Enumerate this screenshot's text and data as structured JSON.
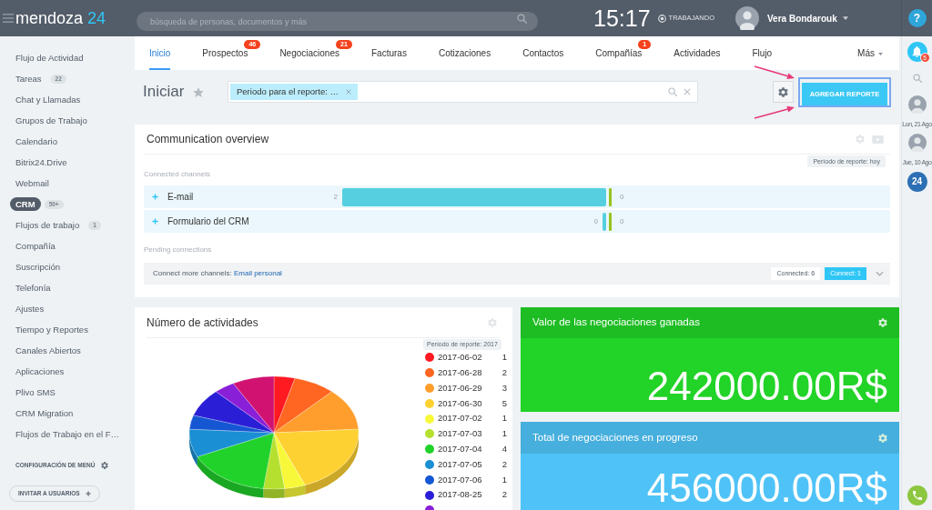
{
  "top_bar": {
    "logo": {
      "name": "mendoza",
      "number": "24"
    },
    "search": {
      "placeholder": "búsqueda de personas, documentos y más"
    },
    "clock": "15:17",
    "work_status": "TRABAJANDO",
    "user_name": "Vera Bondarouk",
    "help": "?"
  },
  "sidebar": {
    "items": [
      {
        "label": "Flujo de Actividad",
        "selected": false
      },
      {
        "label": "Tareas",
        "badge": "22",
        "selected": false
      },
      {
        "label": "Chat y Llamadas",
        "selected": false
      },
      {
        "label": "Grupos de Trabajo",
        "selected": false
      },
      {
        "label": "Calendario",
        "selected": false
      },
      {
        "label": "Bitrix24.Drive",
        "selected": false
      },
      {
        "label": "Webmail",
        "selected": false
      },
      {
        "label": "CRM",
        "badge": "50+",
        "selected": true
      },
      {
        "label": "Flujos de trabajo",
        "badge": "1",
        "selected": false
      },
      {
        "label": "Compañía",
        "selected": false
      },
      {
        "label": "Suscripción",
        "selected": false
      },
      {
        "label": "Telefonía",
        "selected": false
      },
      {
        "label": "Ajustes",
        "selected": false
      },
      {
        "label": "Tiempo y Reportes",
        "selected": false
      },
      {
        "label": "Canales Abiertos",
        "selected": false
      },
      {
        "label": "Aplicaciones",
        "selected": false
      },
      {
        "label": "Plivo SMS",
        "selected": false
      },
      {
        "label": "CRM Migration",
        "selected": false
      },
      {
        "label": "Flujos de Trabajo en el F…",
        "selected": false
      }
    ],
    "menu_settings": "CONFIGURACIÓN DE MENÚ",
    "invite_button": "INVITAR A USUARIOS"
  },
  "tabs": [
    {
      "label": "Inicio",
      "kind": "tab",
      "selected": true
    },
    {
      "label": "Prospectos",
      "kind": "tab",
      "badge": "46",
      "selected": false
    },
    {
      "label": "Negociaciones",
      "kind": "tab",
      "badge": "21",
      "selected": false
    },
    {
      "label": "Facturas",
      "kind": "tab",
      "selected": false
    },
    {
      "label": "Cotizaciones",
      "kind": "tab",
      "selected": false
    },
    {
      "label": "Contactos",
      "kind": "tab",
      "selected": false
    },
    {
      "label": "Compañías",
      "kind": "tab",
      "badge": "1",
      "selected": false
    },
    {
      "label": "Actividades",
      "kind": "tab",
      "selected": false
    },
    {
      "label": "Flujo",
      "kind": "tab",
      "selected": false
    },
    {
      "label": "Más",
      "kind": "menu",
      "selected": false
    }
  ],
  "page_header": {
    "title": "Iniciar",
    "filter": {
      "tag": "Periodo para el reporte: …"
    },
    "add_button": "AGREGAR REPORTE"
  },
  "communication_overview": {
    "title": "Communication overview",
    "period": "Período de reporte: hoy",
    "connected_heading": "Connected channels",
    "chart_data": {
      "type": "bar",
      "orientation": "horizontal",
      "categories": [
        "E-mail",
        "Formulario del CRM"
      ],
      "series": [
        {
          "color": "#56d0e0",
          "values": [
            2,
            0
          ]
        },
        {
          "color": "#98c21e",
          "values": [
            0,
            0
          ]
        }
      ],
      "data_labels": true
    },
    "pending_heading": "Pending connections",
    "pending": {
      "text": "Connect more channels: ",
      "link": "Email personal",
      "connected": "Connected: 6",
      "connect": "Connect: 1"
    }
  },
  "activities": {
    "title": "Número de actividades",
    "period": "Período de reporte: 2017",
    "legend": [
      {
        "label": "2017-06-02",
        "count": "1",
        "color": "#ff1a22"
      },
      {
        "label": "2017-06-28",
        "count": "2",
        "color": "#ff6621"
      },
      {
        "label": "2017-06-29",
        "count": "3",
        "color": "#ff9e2c"
      },
      {
        "label": "2017-06-30",
        "count": "5",
        "color": "#fdd132"
      },
      {
        "label": "2017-07-02",
        "count": "1",
        "color": "#f8f83a"
      },
      {
        "label": "2017-07-03",
        "count": "1",
        "color": "#b5e02f"
      },
      {
        "label": "2017-07-04",
        "count": "4",
        "color": "#21d22a"
      },
      {
        "label": "2017-07-05",
        "count": "2",
        "color": "#1b8fd3"
      },
      {
        "label": "2017-07-06",
        "count": "1",
        "color": "#1556d3"
      },
      {
        "label": "2017-08-25",
        "count": "2",
        "color": "#2a1fd6"
      },
      {
        "color": "#8a1fd8"
      }
    ]
  },
  "kpi_cards": [
    {
      "title": "Valor de las negociaciones ganadas",
      "value": "242000.00R$",
      "color": "#22d328"
    },
    {
      "title": "Total de negociaciones en progreso",
      "value": "456000.00R$",
      "color": "#4fc3f7"
    }
  ],
  "right_rail": {
    "notifications": "5",
    "recent": [
      {
        "date": "Lun, 21 Ago"
      },
      {
        "date": "Jue, 10 Ago"
      }
    ],
    "app_logo": "24"
  }
}
